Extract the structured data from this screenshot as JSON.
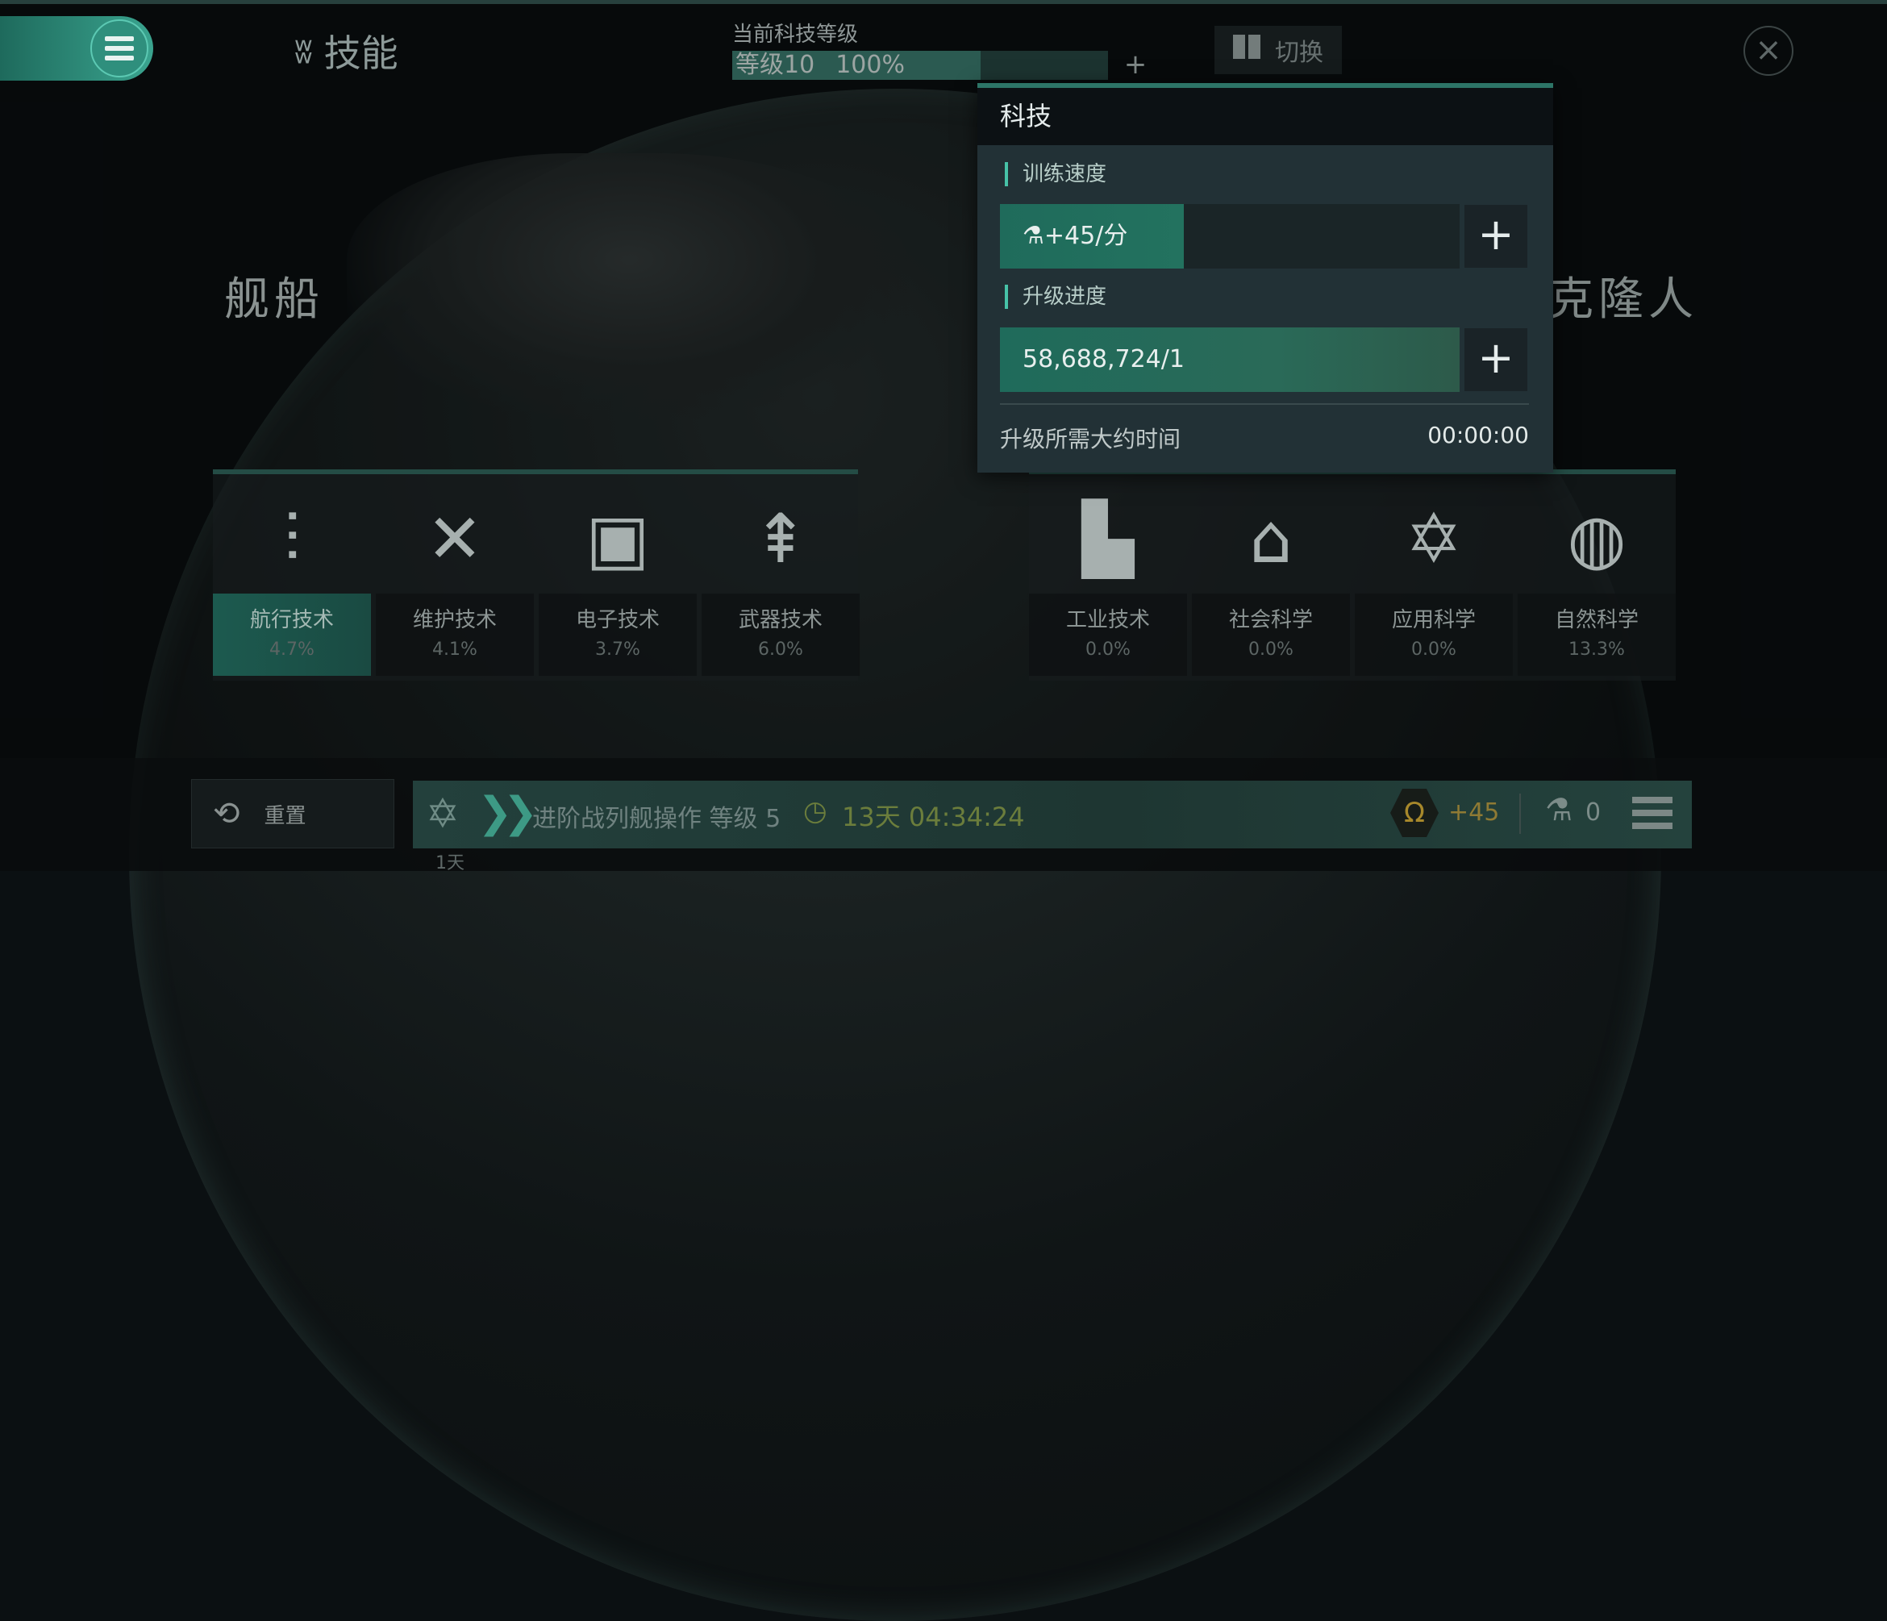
{
  "header": {
    "title": "技能",
    "tech_level_caption": "当前科技等级",
    "tech_level": "等级10",
    "tech_progress_text": "100%",
    "tech_progress": 1.0,
    "plus_label": "+",
    "switch_label": "切换",
    "close_label": "×"
  },
  "sections": {
    "left_title": "舰船",
    "right_title": "克隆人"
  },
  "categories_left": [
    {
      "name": "航行技术",
      "pct": "4.7%",
      "icon": "ship-engine-icon",
      "glyph": "⫶"
    },
    {
      "name": "维护技术",
      "pct": "4.1%",
      "icon": "wrench-screwdriver-icon",
      "glyph": "✕"
    },
    {
      "name": "电子技术",
      "pct": "3.7%",
      "icon": "chip-icon",
      "glyph": "▣"
    },
    {
      "name": "武器技术",
      "pct": "6.0%",
      "icon": "missile-icon",
      "glyph": "⇞"
    }
  ],
  "categories_right": [
    {
      "name": "工业技术",
      "pct": "0.0%",
      "icon": "factory-icon",
      "glyph": "▙"
    },
    {
      "name": "社会科学",
      "pct": "0.0%",
      "icon": "person-badge-icon",
      "glyph": "⌂"
    },
    {
      "name": "应用科学",
      "pct": "0.0%",
      "icon": "atom-icon",
      "glyph": "✡"
    },
    {
      "name": "自然科学",
      "pct": "13.3%",
      "icon": "planet-icon",
      "glyph": "◍"
    }
  ],
  "popup": {
    "title": "科技",
    "training_speed_label": "训练速度",
    "training_speed_value": "+45/分",
    "training_speed_fill": 0.4,
    "upgrade_progress_label": "升级进度",
    "upgrade_progress_value": "58,688,724/1",
    "upgrade_progress_fill": 1.0,
    "eta_label": "升级所需大约时间",
    "eta_value": "00:00:00",
    "plus_label": "+"
  },
  "bottom": {
    "reset_label": "重置",
    "queue_skill": "进阶战列舰操作 等级 5",
    "queue_time": "13天 04:34:24",
    "omega_value": "+45",
    "vial_value": "0",
    "day_label": "1天"
  },
  "colors": {
    "accent": "#2f8f7d",
    "popup_bg": "#223136",
    "bar_fill": "#1f6b5b"
  }
}
